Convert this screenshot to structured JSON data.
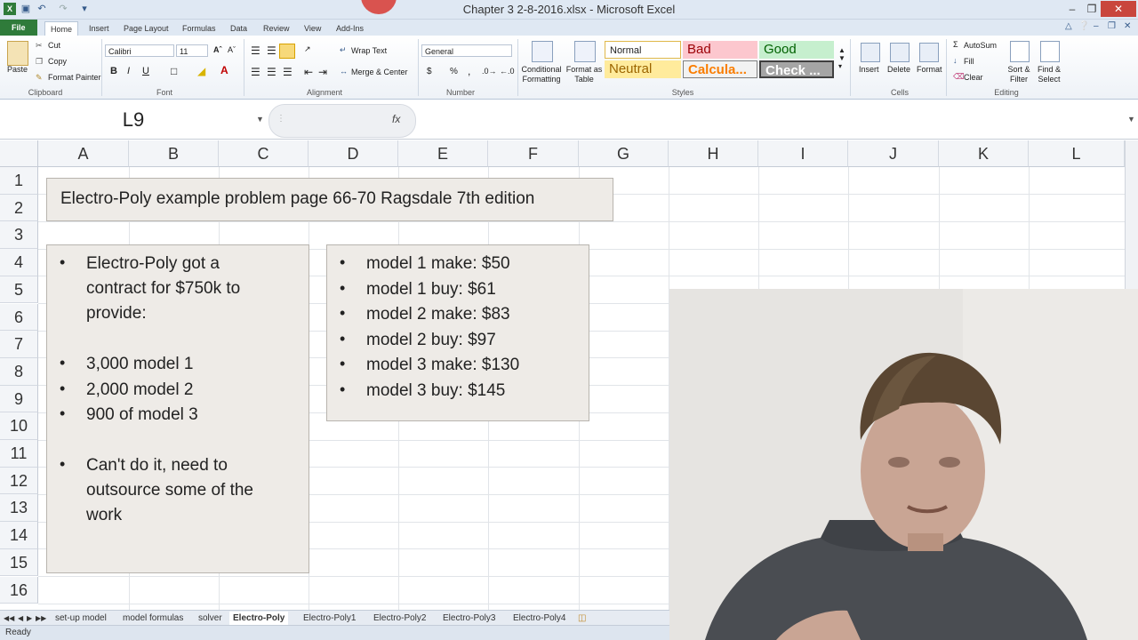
{
  "window": {
    "title": "Chapter 3 2-8-2016.xlsx - Microsoft Excel"
  },
  "ribbon_tabs": [
    "File",
    "Home",
    "Insert",
    "Page Layout",
    "Formulas",
    "Data",
    "Review",
    "View",
    "Add-Ins"
  ],
  "clipboard": {
    "paste": "Paste",
    "cut": "Cut",
    "copy": "Copy",
    "format_painter": "Format Painter",
    "label": "Clipboard"
  },
  "font": {
    "name": "Calibri",
    "size": "11",
    "bold": "B",
    "italic": "I",
    "underline": "U",
    "label": "Font"
  },
  "alignment": {
    "wrap": "Wrap Text",
    "merge": "Merge & Center",
    "label": "Alignment"
  },
  "number": {
    "format": "General",
    "currency": "$",
    "percent": "%",
    "comma": ",",
    "label": "Number"
  },
  "styles": {
    "conditional": "Conditional Formatting",
    "format_table": "Format as Table",
    "normal": "Normal",
    "bad": "Bad",
    "good": "Good",
    "neutral": "Neutral",
    "calculation": "Calcula...",
    "check": "Check ...",
    "label": "Styles"
  },
  "cells": {
    "insert": "Insert",
    "delete": "Delete",
    "format": "Format",
    "label": "Cells"
  },
  "editing": {
    "autosum": "AutoSum",
    "fill": "Fill",
    "clear": "Clear",
    "sort": "Sort & Filter",
    "find": "Find & Select",
    "label": "Editing"
  },
  "formula_bar": {
    "name_box": "L9",
    "fx": "fx",
    "value": ""
  },
  "columns": [
    "A",
    "B",
    "C",
    "D",
    "E",
    "F",
    "G",
    "H",
    "I",
    "J",
    "K",
    "L"
  ],
  "rows": [
    "1",
    "2",
    "3",
    "4",
    "5",
    "6",
    "7",
    "8",
    "9",
    "10",
    "11",
    "12",
    "13",
    "14",
    "15",
    "16"
  ],
  "title_box": {
    "text": "Electro-Poly example problem page 66-70 Ragsdale 7th edition"
  },
  "left_box": {
    "lines": [
      "Electro-Poly got a",
      "contract for $750k to",
      "provide:",
      "3,000 model 1",
      "2,000 model 2",
      "900 of model 3",
      "Can't do it, need to",
      "outsource some of the",
      "work"
    ]
  },
  "right_box": {
    "items": [
      "model 1 make: $50",
      "model 1 buy: $61",
      "model 2 make: $83",
      "model 2 buy: $97",
      "model 3 make: $130",
      "model 3 buy: $145"
    ]
  },
  "sheet_tabs": [
    "set-up model",
    "model formulas",
    "solver",
    "Electro-Poly",
    "Electro-Poly1",
    "Electro-Poly2",
    "Electro-Poly3",
    "Electro-Poly4"
  ],
  "active_sheet": "Electro-Poly",
  "status": {
    "text": "Ready"
  }
}
